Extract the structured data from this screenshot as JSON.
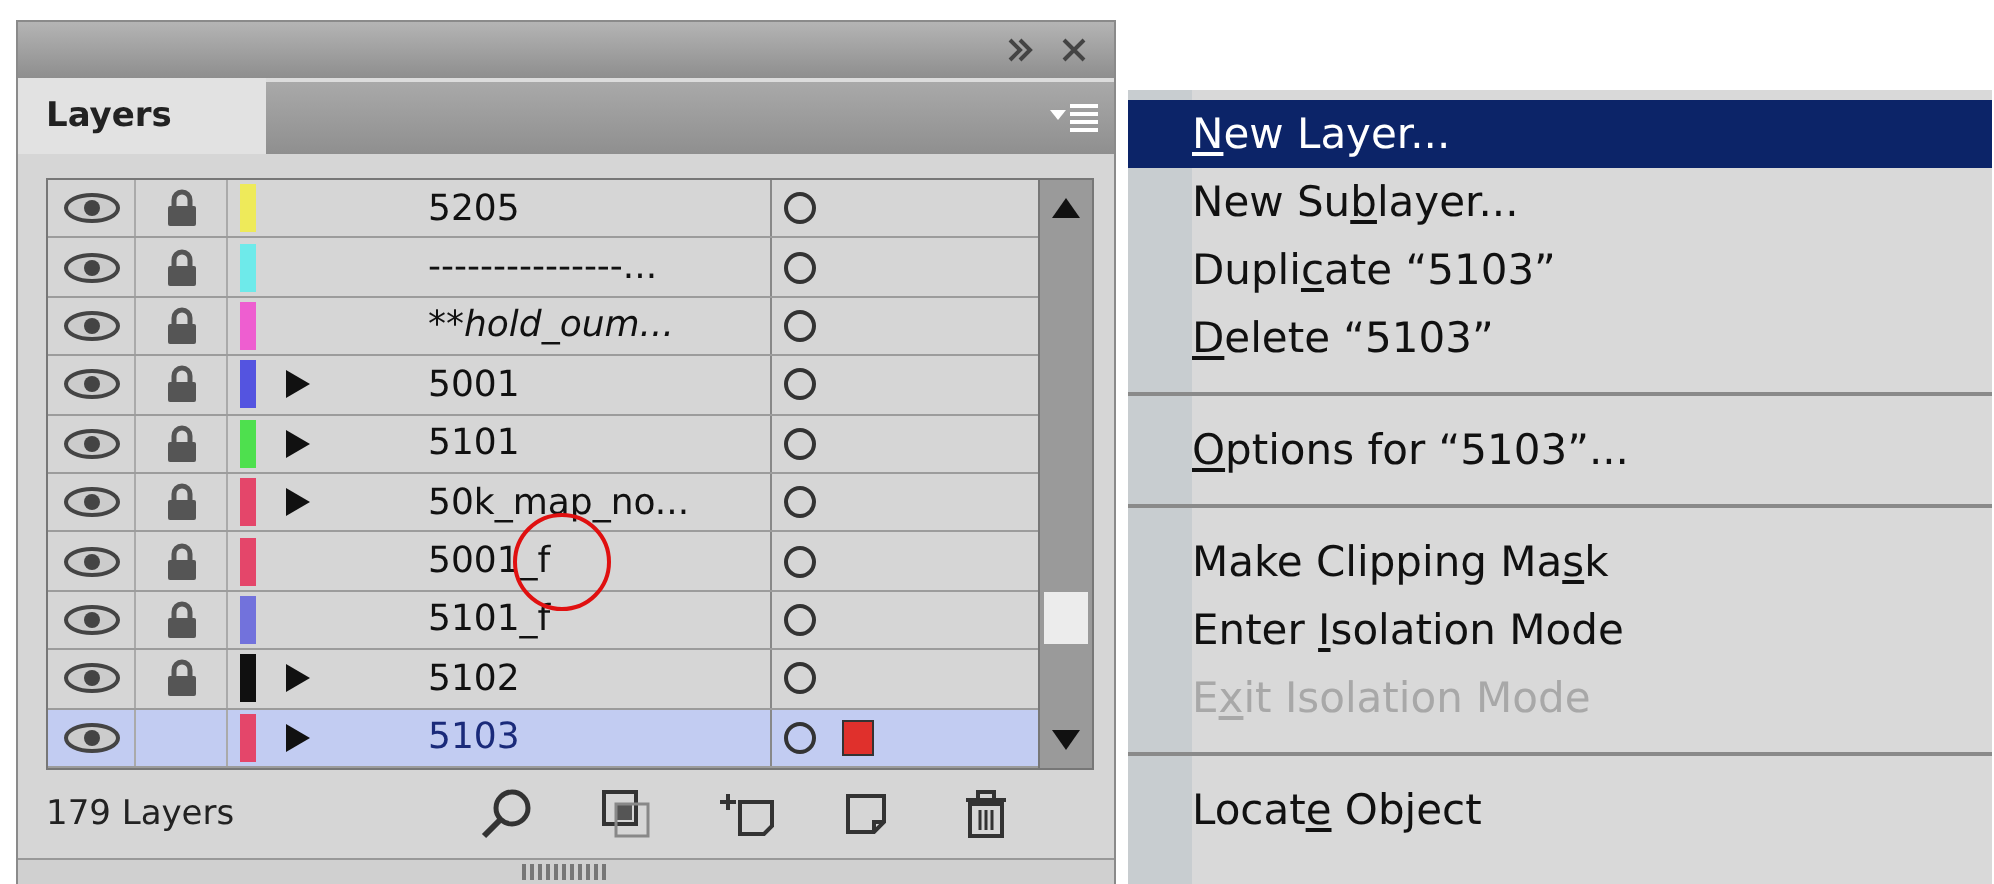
{
  "panel": {
    "tab": "Layers",
    "layers": [
      {
        "name": "5205",
        "color": "#eeea5a",
        "locked": true,
        "expandable": false,
        "italic": false,
        "selected": false,
        "targeted": false,
        "ring": false
      },
      {
        "name": "---------------...",
        "color": "#6eeaea",
        "locked": true,
        "expandable": false,
        "italic": false,
        "selected": false,
        "targeted": false,
        "ring": false
      },
      {
        "name": "**hold_oum...",
        "color": "#ee5ed0",
        "locked": true,
        "expandable": false,
        "italic": true,
        "selected": false,
        "targeted": false,
        "ring": false
      },
      {
        "name": "5001",
        "color": "#5454e0",
        "locked": true,
        "expandable": true,
        "italic": false,
        "selected": false,
        "targeted": false,
        "ring": false
      },
      {
        "name": "5101",
        "color": "#4ee04e",
        "locked": true,
        "expandable": true,
        "italic": false,
        "selected": false,
        "targeted": false,
        "ring": false
      },
      {
        "name": "50k_map_no...",
        "color": "#e4466a",
        "locked": true,
        "expandable": true,
        "italic": false,
        "selected": false,
        "targeted": false,
        "ring": false
      },
      {
        "name": "5001_f",
        "color": "#e4466a",
        "locked": true,
        "expandable": false,
        "italic": false,
        "selected": false,
        "targeted": false,
        "ring": true
      },
      {
        "name": "5101_f",
        "color": "#7272dc",
        "locked": true,
        "expandable": false,
        "italic": false,
        "selected": false,
        "targeted": false,
        "ring": false
      },
      {
        "name": "5102",
        "color": "#101010",
        "locked": true,
        "expandable": true,
        "italic": false,
        "selected": false,
        "targeted": false,
        "ring": false
      },
      {
        "name": "5103",
        "color": "#e4466a",
        "locked": false,
        "expandable": true,
        "italic": false,
        "selected": true,
        "targeted": true,
        "ring": false
      }
    ],
    "status": "179 Layers"
  },
  "menu": {
    "items": [
      {
        "kind": "item",
        "key": "N",
        "after": "ew Layer...",
        "selected": true,
        "disabled": false
      },
      {
        "kind": "item",
        "before": "New Su",
        "key": "b",
        "after": "layer...",
        "selected": false,
        "disabled": false
      },
      {
        "kind": "item",
        "before": "Dupli",
        "key": "c",
        "after": "ate “5103”",
        "selected": false,
        "disabled": false
      },
      {
        "kind": "item",
        "key": "D",
        "after": "elete “5103”",
        "selected": false,
        "disabled": false
      },
      {
        "kind": "separator"
      },
      {
        "kind": "item",
        "key": "O",
        "after": "ptions for “5103”...",
        "selected": false,
        "disabled": false
      },
      {
        "kind": "separator"
      },
      {
        "kind": "item",
        "before": "Make Clipping Ma",
        "key": "s",
        "after": "k",
        "selected": false,
        "disabled": false
      },
      {
        "kind": "item",
        "before": "Enter ",
        "key": "I",
        "after": "solation Mode",
        "selected": false,
        "disabled": false
      },
      {
        "kind": "item",
        "before": "E",
        "key": "x",
        "after": "it Isolation Mode",
        "selected": false,
        "disabled": true
      },
      {
        "kind": "separator"
      },
      {
        "kind": "item",
        "before": "Locat",
        "key": "e",
        "after": " Object",
        "selected": false,
        "disabled": false
      }
    ]
  }
}
